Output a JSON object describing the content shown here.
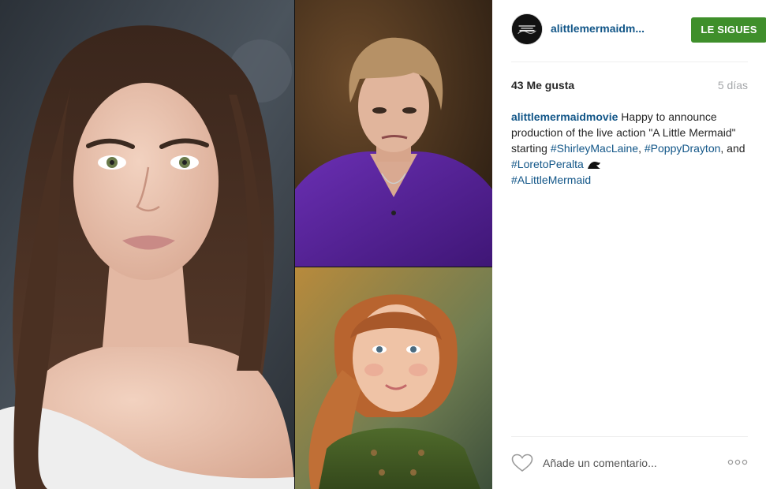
{
  "post": {
    "username": "alittlemermaidm...",
    "follow_label": "LE SIGUES",
    "likes": "43 Me gusta",
    "age": "5 días",
    "caption": {
      "author": "alittlemermaidmovie",
      "text_1": " Happy to announce production of the live action \"A Little Mermaid\" starting ",
      "tag_1": "#ShirleyMacLaine",
      "sep_1": ", ",
      "tag_2": "#PoppyDrayton",
      "sep_2": ", and ",
      "tag_3": "#LoretoPeralta",
      "sep_3": " ",
      "tag_4": "#ALittleMermaid",
      "emoji_icon": "wave-icon"
    },
    "avatar_text": "A LITTLE MERMAID"
  },
  "comment": {
    "placeholder": "Añade un comentario..."
  },
  "icons": {
    "like": "heart-outline-icon",
    "more": "more-options-icon"
  },
  "colors": {
    "link": "#125688",
    "follow_button": "#3f8f2b",
    "muted": "#a5a7aa"
  }
}
